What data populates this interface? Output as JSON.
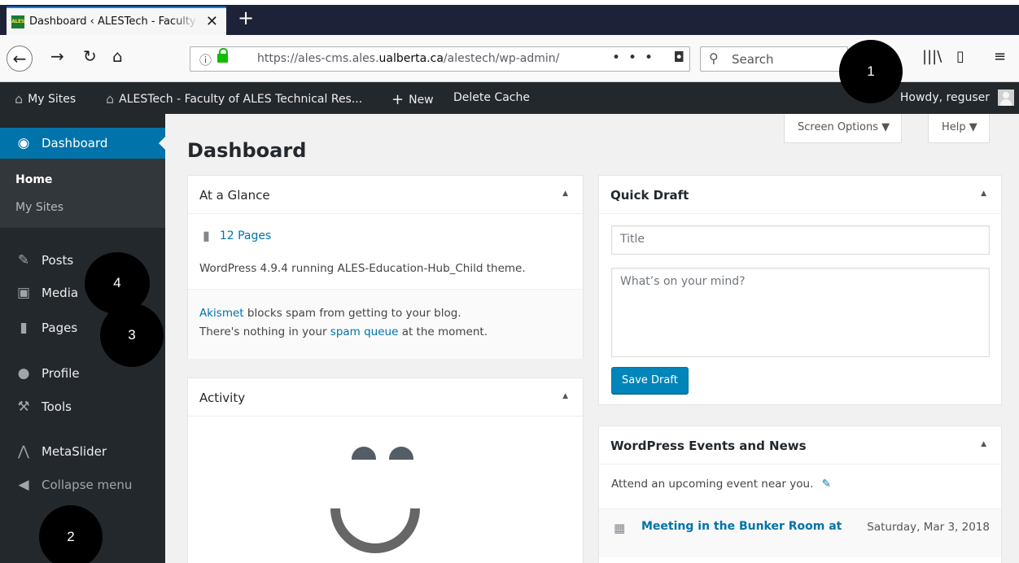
{
  "browser": {
    "tab_title": "Dashboard ‹ ALESTech - Faculty",
    "favicon_text": "ALES",
    "tab_close": "✕",
    "new_tab": "+",
    "url_prefix": "https://ales-cms.ales.",
    "url_domain": "ualberta.ca",
    "url_path": "/alestech/wp-admin/",
    "page_actions": "••• ◘ ☆",
    "search_placeholder": "Search"
  },
  "adminbar": {
    "my_sites": "My Sites",
    "site_name": "ALESTech - Faculty of ALES Technical Res...",
    "new": "New",
    "delete_cache": "Delete Cache",
    "howdy": "Howdy, reguser"
  },
  "sidebar": {
    "dashboard": "Dashboard",
    "home": "Home",
    "my_sites": "My Sites",
    "items": [
      {
        "label": "Posts",
        "icon": "pin-icon"
      },
      {
        "label": "Media",
        "icon": "media-icon"
      },
      {
        "label": "Pages",
        "icon": "pages-icon"
      },
      {
        "label": "Profile",
        "icon": "profile-icon"
      },
      {
        "label": "Tools",
        "icon": "tools-icon"
      },
      {
        "label": "MetaSlider",
        "icon": "metaslider-icon"
      }
    ],
    "collapse": "Collapse menu"
  },
  "main": {
    "title": "Dashboard",
    "screen_options": "Screen Options ▼",
    "help": "Help ▼",
    "at_a_glance": {
      "title": "At a Glance",
      "pages_count": "12 Pages",
      "theme_text": "WordPress 4.9.4 running ALES-Education-Hub_Child theme.",
      "akismet_link": "Akismet",
      "akismet_text": " blocks spam from getting to your blog.",
      "spam_pre": "There's nothing in your ",
      "spam_link": "spam queue",
      "spam_post": " at the moment."
    },
    "activity": {
      "title": "Activity"
    },
    "quick_draft": {
      "title": "Quick Draft",
      "title_placeholder": "Title",
      "content_placeholder": "What’s on your mind?",
      "save_label": "Save Draft"
    },
    "events": {
      "title": "WordPress Events and News",
      "attend_text": "Attend an upcoming event near you.",
      "event_name": "Meeting in the Bunker Room at",
      "event_date": "Saturday, Mar 3, 2018"
    },
    "toggle_arrow": "▲"
  },
  "markers": [
    "1",
    "2",
    "3",
    "4"
  ]
}
